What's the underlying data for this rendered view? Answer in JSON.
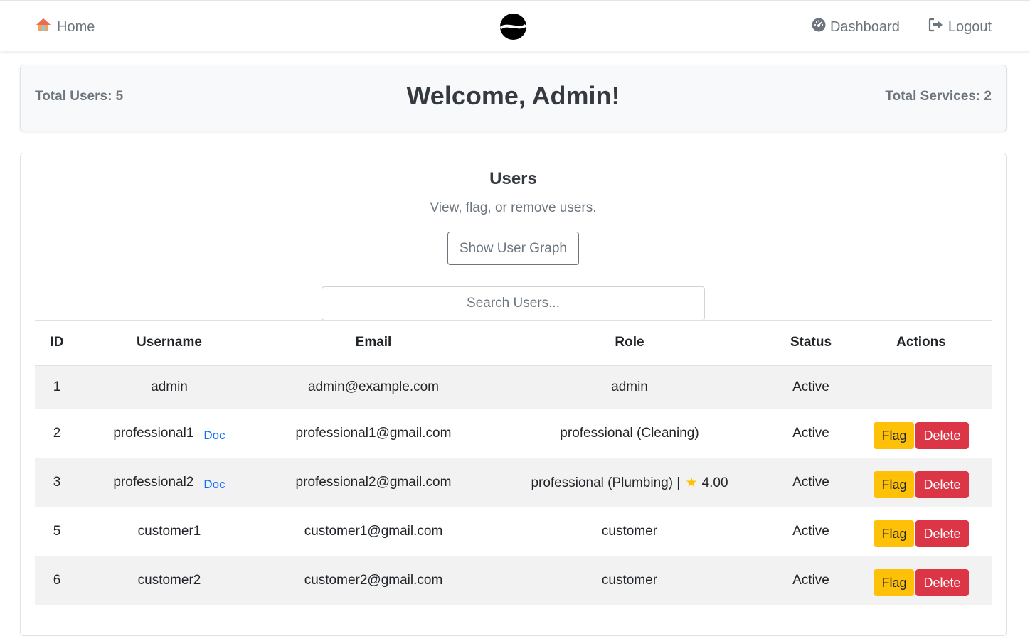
{
  "nav": {
    "home_label": "Home",
    "home_icon": "house-icon",
    "dashboard_label": "Dashboard",
    "dashboard_icon": "gauge-icon",
    "logout_label": "Logout",
    "logout_icon": "sign-out-icon",
    "logo_icon": "s-logo-icon"
  },
  "welcome": {
    "total_users": "Total Users: 5",
    "title": "Welcome, Admin!",
    "total_services": "Total Services: 2"
  },
  "users": {
    "title": "Users",
    "subtitle": "View, flag, or remove users.",
    "graph_button": "Show User Graph",
    "search_placeholder": "Search Users...",
    "columns": [
      "ID",
      "Username",
      "Email",
      "Role",
      "Status",
      "Actions"
    ],
    "flag_label": "Flag",
    "delete_label": "Delete",
    "doc_label": "Doc",
    "rows": [
      {
        "id": "1",
        "username": "admin",
        "email": "admin@example.com",
        "role": "admin",
        "status": "Active"
      },
      {
        "id": "2",
        "username": "professional1",
        "email": "professional1@gmail.com",
        "role": "professional (Cleaning)",
        "status": "Active"
      },
      {
        "id": "3",
        "username": "professional2",
        "email": "professional2@gmail.com",
        "role": "professional (Plumbing) |",
        "rating": "4.00",
        "status": "Active"
      },
      {
        "id": "5",
        "username": "customer1",
        "email": "customer1@gmail.com",
        "role": "customer",
        "status": "Active"
      },
      {
        "id": "6",
        "username": "customer2",
        "email": "customer2@gmail.com",
        "role": "customer",
        "status": "Active"
      }
    ]
  },
  "colors": {
    "active": "#28a745",
    "flag": "#ffc107",
    "delete": "#dc3545",
    "doc": "#0d6efd"
  }
}
